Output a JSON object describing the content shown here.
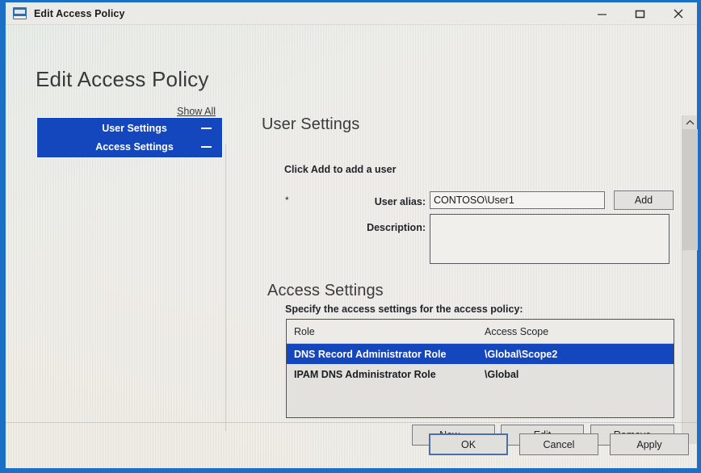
{
  "window": {
    "title": "Edit Access Policy",
    "icon": "ipam-policy-icon",
    "controls": {
      "minimize": "minimize-icon",
      "maximize": "maximize-icon",
      "close": "close-icon"
    }
  },
  "page": {
    "heading": "Edit Access Policy"
  },
  "nav": {
    "show_all": "Show All",
    "items": [
      {
        "label": "User Settings",
        "collapse": "minus-icon"
      },
      {
        "label": "Access Settings",
        "collapse": "minus-icon"
      }
    ]
  },
  "user_settings": {
    "title": "User Settings",
    "hint": "Click Add to add a user",
    "required_marker": "*",
    "alias_label": "User alias:",
    "alias_value": "CONTOSO\\User1",
    "alias_placeholder": "",
    "add_label": "Add",
    "description_label": "Description:",
    "description_value": "",
    "description_placeholder": ""
  },
  "access_settings": {
    "title": "Access Settings",
    "instruction": "Specify the access settings for the access policy:",
    "columns": [
      "Role",
      "Access Scope"
    ],
    "rows": [
      {
        "role": "DNS Record Administrator Role",
        "scope": "\\Global\\Scope2",
        "selected": true
      },
      {
        "role": "IPAM DNS Administrator Role",
        "scope": "\\Global",
        "selected": false
      }
    ],
    "buttons": {
      "new": "New...",
      "edit": "Edit",
      "remove": "Remove"
    }
  },
  "footer": {
    "ok": "OK",
    "cancel": "Cancel",
    "apply": "Apply"
  },
  "scrollbar": {
    "up_arrow": "chevron-up-icon"
  },
  "colors": {
    "accent_blue": "#1446bd",
    "frame_blue": "#1b6fc4",
    "window_bg": "#e9e7e4",
    "selected_row": "#1446bd"
  }
}
